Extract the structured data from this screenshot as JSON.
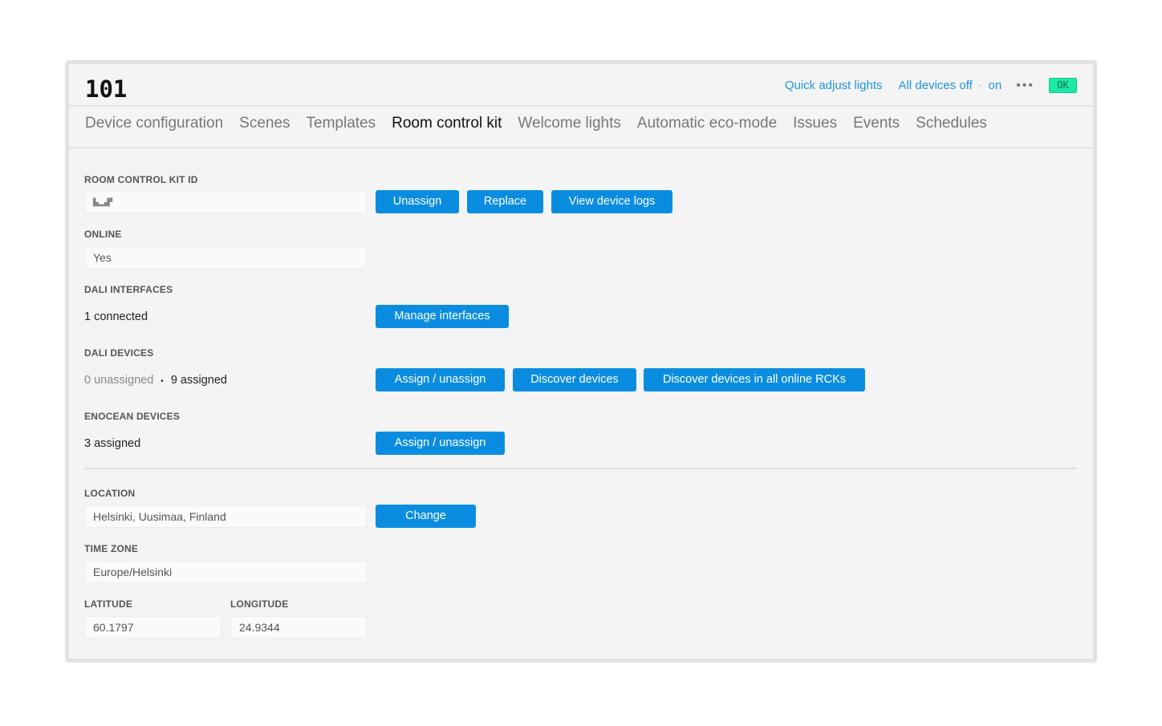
{
  "header": {
    "title": "101",
    "quick_adjust": "Quick adjust lights",
    "all_devices_off": "All devices off",
    "separator": "·",
    "on": "on",
    "more": "•••",
    "status": "OK"
  },
  "tabs": [
    "Device configuration",
    "Scenes",
    "Templates",
    "Room control kit",
    "Welcome lights",
    "Automatic eco-mode",
    "Issues",
    "Events",
    "Schedules"
  ],
  "rck": {
    "label": "ROOM CONTROL KIT ID",
    "value": "▙▂▟▘",
    "unassign": "Unassign",
    "replace": "Replace",
    "logs": "View device logs"
  },
  "online": {
    "label": "ONLINE",
    "value": "Yes"
  },
  "dali_if": {
    "label": "DALI INTERFACES",
    "value": "1 connected",
    "manage": "Manage interfaces"
  },
  "dali_dev": {
    "label": "DALI DEVICES",
    "unassigned": "0 unassigned",
    "dot": "•",
    "assigned": "9 assigned",
    "assign": "Assign / unassign",
    "discover": "Discover devices",
    "discover_all": "Discover devices in all online RCKs"
  },
  "enocean": {
    "label": "ENOCEAN DEVICES",
    "value": "3 assigned",
    "assign": "Assign / unassign"
  },
  "location": {
    "label": "LOCATION",
    "value": "Helsinki, Uusimaa, Finland",
    "change": "Change"
  },
  "timezone": {
    "label": "TIME ZONE",
    "value": "Europe/Helsinki"
  },
  "latitude": {
    "label": "LATITUDE",
    "value": "60.1797"
  },
  "longitude": {
    "label": "LONGITUDE",
    "value": "24.9344"
  }
}
